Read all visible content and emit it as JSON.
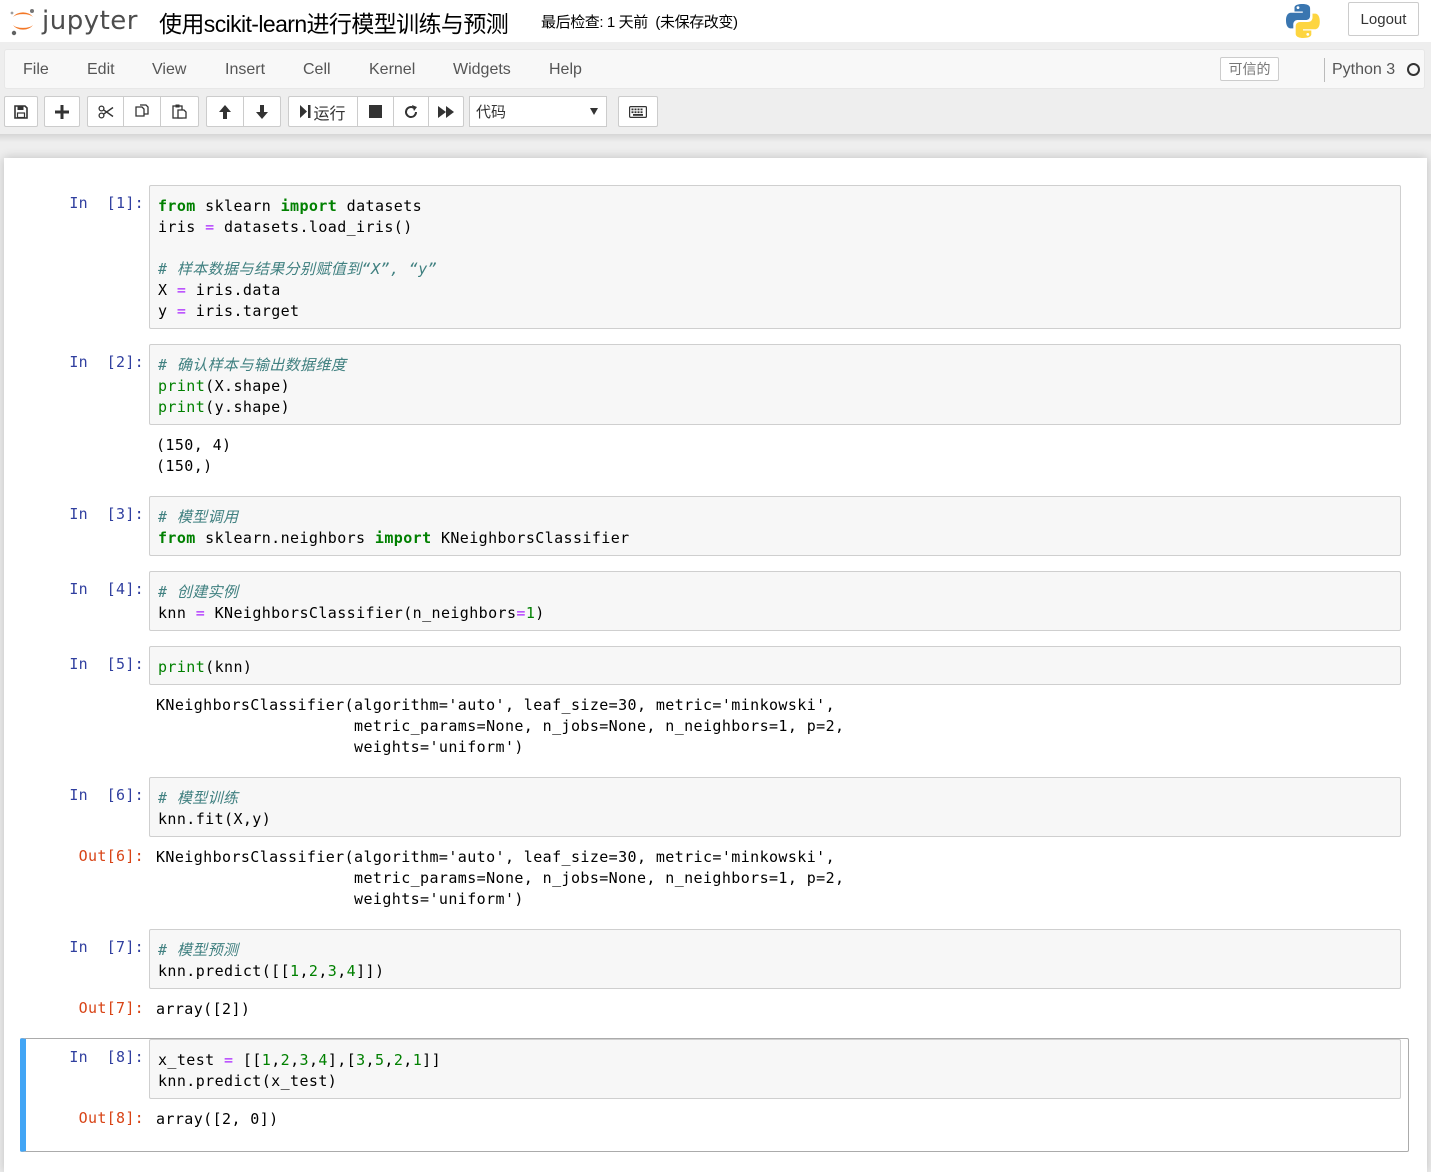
{
  "header": {
    "logo_text": "jupyter",
    "notebook_title": "使用scikit-learn进行模型训练与预测",
    "checkpoint_status": "最后检查: 1 天前",
    "autosave_status": "(未保存改变)",
    "logout_label": "Logout"
  },
  "menubar": {
    "items": [
      "File",
      "Edit",
      "View",
      "Insert",
      "Cell",
      "Kernel",
      "Widgets",
      "Help"
    ],
    "trusted_label": "可信的",
    "kernel_name": "Python 3"
  },
  "toolbar": {
    "run_label": "运行",
    "cell_type": "代码",
    "buttons": [
      "save-icon",
      "plus-icon",
      "cut-icon",
      "copy-icon",
      "paste-icon",
      "arrow-up-icon",
      "arrow-down-icon",
      "step-forward-icon",
      "stop-icon",
      "refresh-icon",
      "fast-forward-icon",
      "keyboard-icon"
    ]
  },
  "cells": [
    {
      "prompt": "In  [1]:",
      "code": [
        [
          [
            "kw",
            "from"
          ],
          [
            "t",
            " sklearn "
          ],
          [
            "kw",
            "import"
          ],
          [
            "t",
            " datasets"
          ]
        ],
        [
          [
            "t",
            "iris "
          ],
          [
            "op",
            "="
          ],
          [
            "t",
            " datasets.load_iris()"
          ]
        ],
        [],
        [
          [
            "cm",
            "# 样本数据与结果分别赋值到“X”, “y”"
          ]
        ],
        [
          [
            "t",
            "X "
          ],
          [
            "op",
            "="
          ],
          [
            "t",
            " iris.data"
          ]
        ],
        [
          [
            "t",
            "y "
          ],
          [
            "op",
            "="
          ],
          [
            "t",
            " iris.target"
          ]
        ]
      ]
    },
    {
      "prompt": "In  [2]:",
      "code": [
        [
          [
            "cm",
            "# 确认样本与输出数据维度"
          ]
        ],
        [
          [
            "nb",
            "print"
          ],
          [
            "t",
            "(X.shape)"
          ]
        ],
        [
          [
            "nb",
            "print"
          ],
          [
            "t",
            "(y.shape)"
          ]
        ]
      ],
      "output": [
        "(150, 4)",
        "(150,)"
      ]
    },
    {
      "prompt": "In  [3]:",
      "code": [
        [
          [
            "cm",
            "# 模型调用"
          ]
        ],
        [
          [
            "kw",
            "from"
          ],
          [
            "t",
            " sklearn.neighbors "
          ],
          [
            "kw",
            "import"
          ],
          [
            "t",
            " KNeighborsClassifier"
          ]
        ]
      ]
    },
    {
      "prompt": "In  [4]:",
      "code": [
        [
          [
            "cm",
            "# 创建实例"
          ]
        ],
        [
          [
            "t",
            "knn "
          ],
          [
            "op",
            "="
          ],
          [
            "t",
            " KNeighborsClassifier(n_neighbors"
          ],
          [
            "op",
            "="
          ],
          [
            "nm",
            "1"
          ],
          [
            "t",
            ")"
          ]
        ]
      ]
    },
    {
      "prompt": "In  [5]:",
      "code": [
        [
          [
            "nb",
            "print"
          ],
          [
            "t",
            "(knn)"
          ]
        ]
      ],
      "output": [
        "KNeighborsClassifier(algorithm='auto', leaf_size=30, metric='minkowski',",
        "                     metric_params=None, n_jobs=None, n_neighbors=1, p=2,",
        "                     weights='uniform')"
      ]
    },
    {
      "prompt": "In  [6]:",
      "code": [
        [
          [
            "cm",
            "# 模型训练"
          ]
        ],
        [
          [
            "t",
            "knn.fit(X,y)"
          ]
        ]
      ],
      "out_prompt": "Out[6]:",
      "output": [
        "KNeighborsClassifier(algorithm='auto', leaf_size=30, metric='minkowski',",
        "                     metric_params=None, n_jobs=None, n_neighbors=1, p=2,",
        "                     weights='uniform')"
      ]
    },
    {
      "prompt": "In  [7]:",
      "code": [
        [
          [
            "cm",
            "# 模型预测"
          ]
        ],
        [
          [
            "t",
            "knn.predict([["
          ],
          [
            "nm",
            "1"
          ],
          [
            "t",
            ","
          ],
          [
            "nm",
            "2"
          ],
          [
            "t",
            ","
          ],
          [
            "nm",
            "3"
          ],
          [
            "t",
            ","
          ],
          [
            "nm",
            "4"
          ],
          [
            "t",
            "]])"
          ]
        ]
      ],
      "out_prompt": "Out[7]:",
      "output": [
        "array([2])"
      ]
    },
    {
      "prompt": "In  [8]:",
      "code": [
        [
          [
            "t",
            "x_test "
          ],
          [
            "op",
            "="
          ],
          [
            "t",
            " [["
          ],
          [
            "nm",
            "1"
          ],
          [
            "t",
            ","
          ],
          [
            "nm",
            "2"
          ],
          [
            "t",
            ","
          ],
          [
            "nm",
            "3"
          ],
          [
            "t",
            ","
          ],
          [
            "nm",
            "4"
          ],
          [
            "t",
            "],["
          ],
          [
            "nm",
            "3"
          ],
          [
            "t",
            ","
          ],
          [
            "nm",
            "5"
          ],
          [
            "t",
            ","
          ],
          [
            "nm",
            "2"
          ],
          [
            "t",
            ","
          ],
          [
            "nm",
            "1"
          ],
          [
            "t",
            "]]"
          ]
        ],
        [
          [
            "t",
            "knn.predict(x_test)"
          ]
        ]
      ],
      "out_prompt": "Out[8]:",
      "output": [
        "array([2, 0])"
      ],
      "selected": true
    }
  ]
}
